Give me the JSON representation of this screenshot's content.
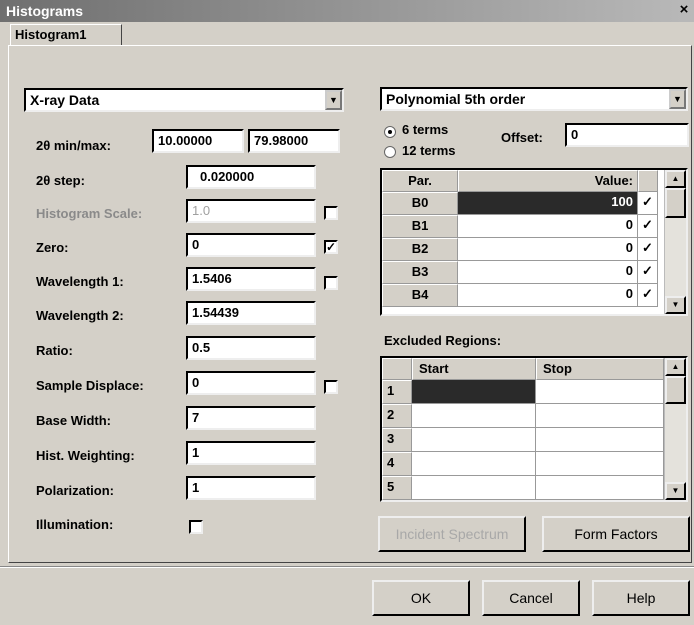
{
  "window": {
    "title": "Histograms",
    "close_glyph": "×"
  },
  "tab": {
    "label": "Histogram1"
  },
  "data_source": {
    "selected": "X-ray Data"
  },
  "fields": {
    "two_theta_label": "2θ min/max:",
    "min_value": "10.00000",
    "max_value": "79.98000",
    "step_label": "2θ step:",
    "step_value": "0.020000",
    "hist_scale_label": "Histogram Scale:",
    "hist_scale_value": "1.0",
    "zero_label": "Zero:",
    "zero_value": "0",
    "wl1_label": "Wavelength 1:",
    "wl1_value": "1.5406",
    "wl2_label": "Wavelength 2:",
    "wl2_value": "1.54439",
    "ratio_label": "Ratio:",
    "ratio_value": "0.5",
    "sample_disp_label": "Sample Displace:",
    "sample_disp_value": "0",
    "base_width_label": "Base Width:",
    "base_width_value": "7",
    "hist_weight_label": "Hist. Weighting:",
    "hist_weight_value": "1",
    "polarization_label": "Polarization:",
    "polarization_value": "1",
    "illumination_label": "Illumination:"
  },
  "checks": {
    "hist_scale": "",
    "zero": "✓",
    "wl1": "",
    "sample_disp": "",
    "illumination": ""
  },
  "background": {
    "function": "Polynomial 5th order",
    "terms6": "6 terms",
    "terms12": "12 terms",
    "offset_label": "Offset:",
    "offset_value": "0",
    "header_par": "Par.",
    "header_value": "Value:",
    "params": [
      {
        "name": "B0",
        "value": "100",
        "check": "✓"
      },
      {
        "name": "B1",
        "value": "0",
        "check": "✓"
      },
      {
        "name": "B2",
        "value": "0",
        "check": "✓"
      },
      {
        "name": "B3",
        "value": "0",
        "check": "✓"
      },
      {
        "name": "B4",
        "value": "0",
        "check": "✓"
      }
    ]
  },
  "excluded": {
    "label": "Excluded Regions:",
    "header_start": "Start",
    "header_stop": "Stop",
    "rows": [
      "1",
      "2",
      "3",
      "4",
      "5"
    ]
  },
  "buttons": {
    "incident": "Incident Spectrum",
    "form_factors": "Form Factors",
    "ok": "OK",
    "cancel": "Cancel",
    "help": "Help"
  },
  "icons": {
    "scroll_up": "▲",
    "scroll_down": "▼",
    "combo_arrow": "▼"
  }
}
